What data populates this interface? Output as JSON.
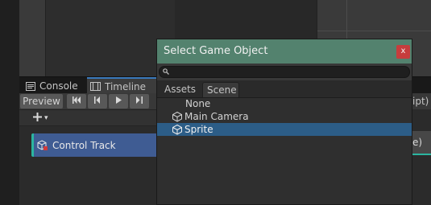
{
  "tabs": {
    "console": "Console",
    "timeline": "Timeline"
  },
  "toolbar": {
    "preview": "Preview",
    "buttons": [
      "jump-to-start-icon",
      "previous-frame-icon",
      "play-icon",
      "next-frame-icon"
    ]
  },
  "track": {
    "add_icon": "plus-icon",
    "add_caret": "▾",
    "control_track_label": "Control Track"
  },
  "right_panel": {
    "partial_header": "ipt)",
    "partial_clip": "e)"
  },
  "dialog": {
    "title": "Select Game Object",
    "close_label": "x",
    "search_placeholder": "",
    "tabs": [
      "Assets",
      "Scene"
    ],
    "active_tab": "Scene",
    "items": [
      {
        "label": "None",
        "icon": "",
        "selected": false
      },
      {
        "label": "Main Camera",
        "icon": "cube-icon",
        "selected": false
      },
      {
        "label": "Sprite",
        "icon": "cube-icon",
        "selected": true
      }
    ]
  },
  "colors": {
    "title_bar": "#53826e",
    "close_button": "#c63d3d",
    "selection": "#2c5d87",
    "track": "#3f5c93",
    "track_accent": "#2bb5a0",
    "timeline_tab_accent": "#3a79bb"
  }
}
